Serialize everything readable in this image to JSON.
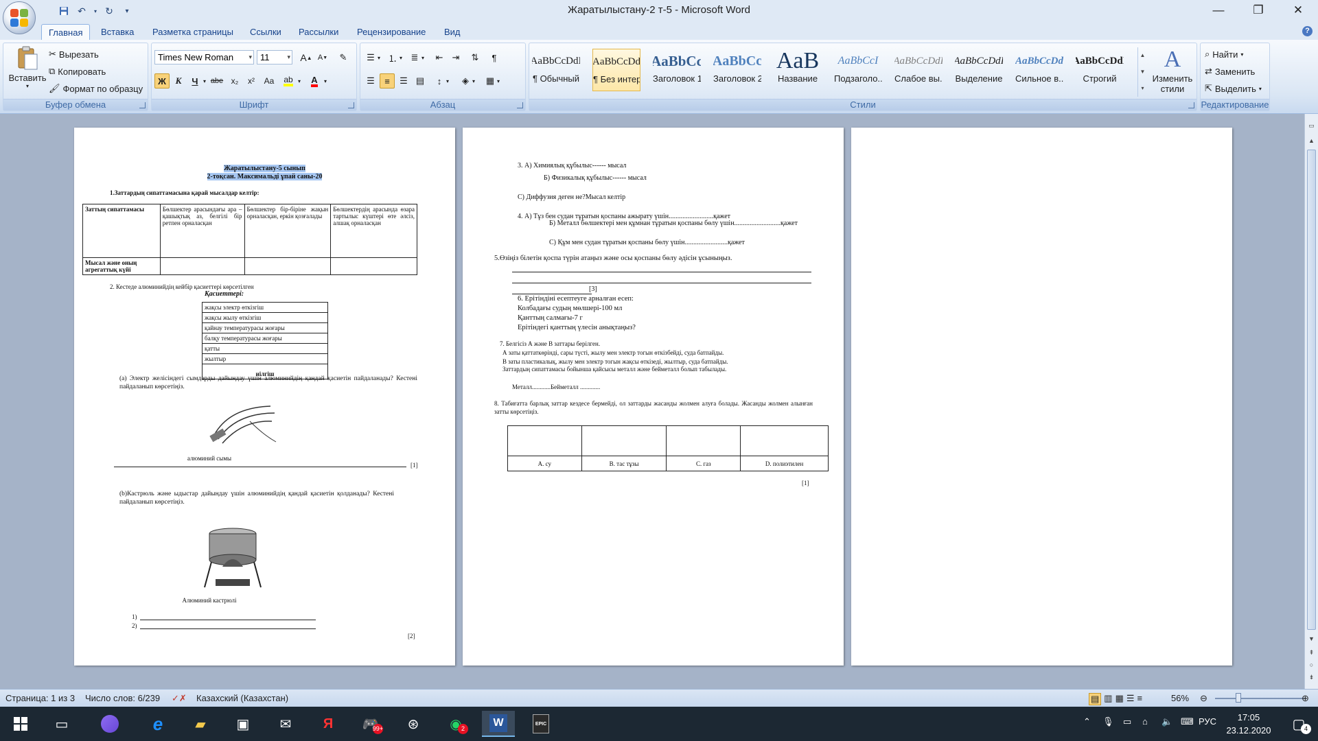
{
  "window": {
    "title": "Жаратылыстану-2 т-5 - Microsoft Word",
    "minimize": "—",
    "restore": "❐",
    "close": "✕"
  },
  "qat": {
    "save_icon": "save-icon",
    "undo_icon": "undo-icon",
    "redo_icon": "redo-icon",
    "customize_icon": "customize-icon"
  },
  "tabs": [
    "Главная",
    "Вставка",
    "Разметка страницы",
    "Ссылки",
    "Рассылки",
    "Рецензирование",
    "Вид"
  ],
  "clipboard": {
    "paste": "Вставить",
    "cut": "Вырезать",
    "copy": "Копировать",
    "format_painter": "Формат по образцу",
    "label": "Буфер обмена"
  },
  "font": {
    "family": "Times New Roman",
    "size": "11",
    "label": "Шрифт",
    "bold": "Ж",
    "italic": "К",
    "underline": "Ч",
    "strike": "abe",
    "sub": "x₂",
    "sup": "x²",
    "case": "Aa",
    "grow": "A",
    "shrink": "A",
    "highlight_color": "#ffff00",
    "font_color": "#ff0000"
  },
  "paragraph": {
    "label": "Абзац"
  },
  "styles": {
    "label": "Стили",
    "items": [
      {
        "sample": "AaBbCcDdI",
        "name": "¶ Обычный"
      },
      {
        "sample": "AaBbCcDd",
        "name": "¶ Без интер..."
      },
      {
        "sample": "AaBbCc",
        "name": "Заголовок 1"
      },
      {
        "sample": "AaBbCc",
        "name": "Заголовок 2"
      },
      {
        "sample": "AaB",
        "name": "Название"
      },
      {
        "sample": "AaBbCcI",
        "name": "Подзаголо..."
      },
      {
        "sample": "AaBbCcDdI",
        "name": "Слабое вы..."
      },
      {
        "sample": "AaBbCcDdI",
        "name": "Выделение"
      },
      {
        "sample": "AaBbCcDd",
        "name": "Сильное в..."
      },
      {
        "sample": "AaBbCcDdI",
        "name": "Строгий"
      }
    ],
    "change": "Изменить стили"
  },
  "editing": {
    "label": "Редактирование",
    "find": "Найти",
    "replace": "Заменить",
    "select": "Выделить"
  },
  "page1": {
    "title1": "Жаратылыстану-5 сынып",
    "title2": "2-тоқсан. Максимальді ұпай саны-20",
    "q1": "1.Заттардың сипаттамасына қарай мысалдар келтір:",
    "table1": {
      "h0": "Заттың сипаттамасы",
      "h1": "Бөлшектер арасындағы ара – қашықтық аз, белгілі бір ретпен орналасқан",
      "h2": "Бөлшектер бір-біріне жақын орналасқан, еркін қозғалады",
      "h3": "Бөлшектердің арасында өзара тартылыс күштері өте әлсіз, алшақ орналасқан",
      "r0": "Мысал және оның агрегаттық күйі"
    },
    "q2": "2.   Кестеде алюминийдің кейбір қасиеттері көрсетілген",
    "props_header": "Қасиеттері:",
    "props": [
      "жақсы электр өткізгіш",
      "жақсы жылу өткізгіш",
      "қайнау температурасы жоғары",
      "балқу температурасы жоғары",
      "қатты",
      "жылтыр"
    ],
    "props_footer": "иілгіш",
    "qa": "(а)  Электр желісіндегі сымдарды дайындау үшін алюминийдің қандай қасиетін пайдаланады? Кестені пайдаланып көрсетіңіз.",
    "img1_caption": "алюминий сымы",
    "mark1": "[1]",
    "qb": "(b)Кастрюль және ыдыстар дайындау үшін алюминийдің қандай қасиетін қолданады? Кестені пайдаланып көрсетіңіз.",
    "img2_caption": "Алюминий кастрюлі",
    "line1": "1)",
    "line2": "2)",
    "mark2": "[2]"
  },
  "page2": {
    "q3a": "3.        А) Химиялық құбылыс------ мысал",
    "q3b": "Б) Физикалық құбылыс------ мысал",
    "q3c": "С) Диффузия деген не?Мысал келтір",
    "q4a": "4.        А) Тұз бен судан тұратын қоспаны ажырату үшін..........................қажет",
    "q4b": "Б)  Металл бөлшектері мен құмнан тұратын қоспаны бөлу үшін...........................қажет",
    "q4c": "С) Құм мен судан тұратын қоспаны бөлу үшін.........................қажет",
    "q5": "5.Өзіңіз білетін қоспа түрін атаңыз және осы қоспаны бөлу әдісін ұсыныңыз.",
    "mark3": "[3]",
    "q6": "6.        Ерітіндіні есептеуге арналған есеп:",
    "q6a": "Колбадағы судың мөлшері-100 мл",
    "q6b": "Қанттың салмағы-7 г",
    "q6c": "Ерітіндегі қанттың үлесін анықтаңыз?",
    "q7": "7. Белгісіз А және В заттары берілген.",
    "q7a": "А  заты қаттаткөрінді, сары түсті, жылу мен электр тогын өткізбейді, суда батпайды.",
    "q7b": "В  заты пластикалық, жылу мен электр тогын жақсы өткізеді, жылтыр, суда батпайды.",
    "q7c": "Заттардың сипаттамасы бойынша қайсысы металл және бейметалл болып табылады.",
    "q7d": "Металл............Бейметалл .............",
    "q8": "8.  Табиғатта барлық заттар кездесе бермейді, ол заттарды жасанды жолмен алуға болады. Жасанды жолмен алынған затты көрсетіңіз.",
    "opts": [
      "А.  су",
      "В. тас тұзы",
      "С. газ",
      "D. полиэтилен"
    ],
    "mark4": "[1]"
  },
  "status": {
    "page": "Страница: 1 из 3",
    "words": "Число слов: 6/239",
    "lang": "Казахский (Казахстан)",
    "zoom": "56%"
  },
  "taskbar": {
    "lang": "РУС",
    "time": "17:05",
    "date": "23.12.2020",
    "mail_badge": "99+",
    "whatsapp_badge": "2",
    "notif_badge": "4",
    "epic_label": "EPIC"
  }
}
